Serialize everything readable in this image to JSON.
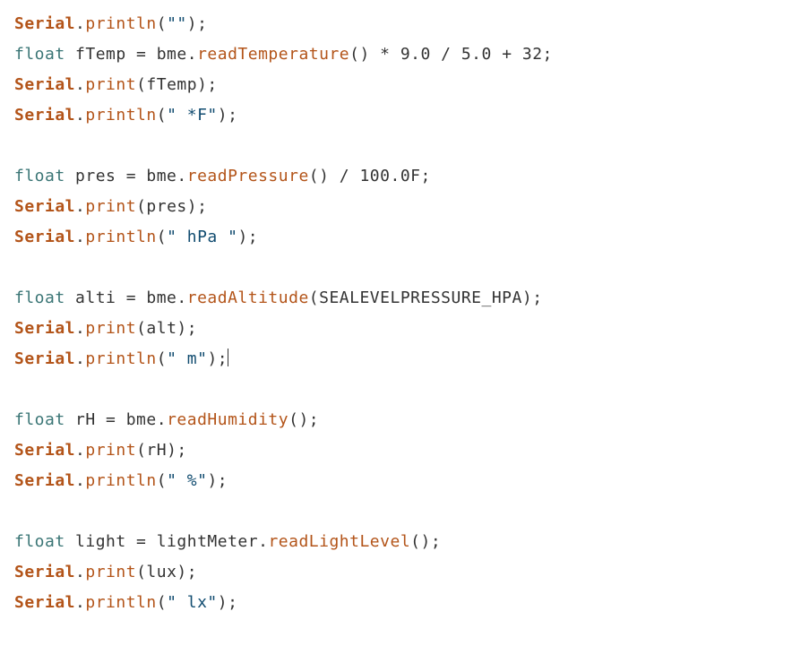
{
  "code": {
    "lines": [
      {
        "segments": [
          {
            "cls": "obj",
            "t": "Serial"
          },
          {
            "cls": "op",
            "t": "."
          },
          {
            "cls": "mem",
            "t": "println"
          },
          {
            "cls": "op",
            "t": "("
          },
          {
            "cls": "str",
            "t": "\"\""
          },
          {
            "cls": "op",
            "t": ");"
          }
        ]
      },
      {
        "segments": [
          {
            "cls": "kw",
            "t": "float"
          },
          {
            "cls": "op",
            "t": " fTemp = bme."
          },
          {
            "cls": "mem",
            "t": "readTemperature"
          },
          {
            "cls": "op",
            "t": "() * 9.0 / 5.0 + 32;"
          }
        ]
      },
      {
        "segments": [
          {
            "cls": "obj",
            "t": "Serial"
          },
          {
            "cls": "op",
            "t": "."
          },
          {
            "cls": "mem",
            "t": "print"
          },
          {
            "cls": "op",
            "t": "(fTemp);"
          }
        ]
      },
      {
        "segments": [
          {
            "cls": "obj",
            "t": "Serial"
          },
          {
            "cls": "op",
            "t": "."
          },
          {
            "cls": "mem",
            "t": "println"
          },
          {
            "cls": "op",
            "t": "("
          },
          {
            "cls": "str",
            "t": "\" *F\""
          },
          {
            "cls": "op",
            "t": ");"
          }
        ]
      },
      {
        "segments": [
          {
            "cls": "op",
            "t": ""
          }
        ]
      },
      {
        "segments": [
          {
            "cls": "kw",
            "t": "float"
          },
          {
            "cls": "op",
            "t": " pres = bme."
          },
          {
            "cls": "mem",
            "t": "readPressure"
          },
          {
            "cls": "op",
            "t": "() / 100.0F;"
          }
        ]
      },
      {
        "segments": [
          {
            "cls": "obj",
            "t": "Serial"
          },
          {
            "cls": "op",
            "t": "."
          },
          {
            "cls": "mem",
            "t": "print"
          },
          {
            "cls": "op",
            "t": "(pres);"
          }
        ]
      },
      {
        "segments": [
          {
            "cls": "obj",
            "t": "Serial"
          },
          {
            "cls": "op",
            "t": "."
          },
          {
            "cls": "mem",
            "t": "println"
          },
          {
            "cls": "op",
            "t": "("
          },
          {
            "cls": "str",
            "t": "\" hPa \""
          },
          {
            "cls": "op",
            "t": ");"
          }
        ]
      },
      {
        "segments": [
          {
            "cls": "op",
            "t": ""
          }
        ]
      },
      {
        "segments": [
          {
            "cls": "kw",
            "t": "float"
          },
          {
            "cls": "op",
            "t": " alti = bme."
          },
          {
            "cls": "mem",
            "t": "readAltitude"
          },
          {
            "cls": "op",
            "t": "(SEALEVELPRESSURE_HPA);"
          }
        ]
      },
      {
        "segments": [
          {
            "cls": "obj",
            "t": "Serial"
          },
          {
            "cls": "op",
            "t": "."
          },
          {
            "cls": "mem",
            "t": "print"
          },
          {
            "cls": "op",
            "t": "(alt);"
          }
        ]
      },
      {
        "segments": [
          {
            "cls": "obj",
            "t": "Serial"
          },
          {
            "cls": "op",
            "t": "."
          },
          {
            "cls": "mem",
            "t": "println"
          },
          {
            "cls": "op",
            "t": "("
          },
          {
            "cls": "str",
            "t": "\" m\""
          },
          {
            "cls": "op",
            "t": ");"
          }
        ],
        "cursorAfter": true
      },
      {
        "segments": [
          {
            "cls": "op",
            "t": ""
          }
        ]
      },
      {
        "segments": [
          {
            "cls": "kw",
            "t": "float"
          },
          {
            "cls": "op",
            "t": " rH = bme."
          },
          {
            "cls": "mem",
            "t": "readHumidity"
          },
          {
            "cls": "op",
            "t": "();"
          }
        ]
      },
      {
        "segments": [
          {
            "cls": "obj",
            "t": "Serial"
          },
          {
            "cls": "op",
            "t": "."
          },
          {
            "cls": "mem",
            "t": "print"
          },
          {
            "cls": "op",
            "t": "(rH);"
          }
        ]
      },
      {
        "segments": [
          {
            "cls": "obj",
            "t": "Serial"
          },
          {
            "cls": "op",
            "t": "."
          },
          {
            "cls": "mem",
            "t": "println"
          },
          {
            "cls": "op",
            "t": "("
          },
          {
            "cls": "str",
            "t": "\" %\""
          },
          {
            "cls": "op",
            "t": ");"
          }
        ]
      },
      {
        "segments": [
          {
            "cls": "op",
            "t": ""
          }
        ]
      },
      {
        "segments": [
          {
            "cls": "kw",
            "t": "float"
          },
          {
            "cls": "op",
            "t": " light = lightMeter."
          },
          {
            "cls": "mem",
            "t": "readLightLevel"
          },
          {
            "cls": "op",
            "t": "();"
          }
        ]
      },
      {
        "segments": [
          {
            "cls": "obj",
            "t": "Serial"
          },
          {
            "cls": "op",
            "t": "."
          },
          {
            "cls": "mem",
            "t": "print"
          },
          {
            "cls": "op",
            "t": "(lux);"
          }
        ]
      },
      {
        "segments": [
          {
            "cls": "obj",
            "t": "Serial"
          },
          {
            "cls": "op",
            "t": "."
          },
          {
            "cls": "mem",
            "t": "println"
          },
          {
            "cls": "op",
            "t": "("
          },
          {
            "cls": "str",
            "t": "\" lx\""
          },
          {
            "cls": "op",
            "t": ");"
          }
        ]
      }
    ]
  }
}
